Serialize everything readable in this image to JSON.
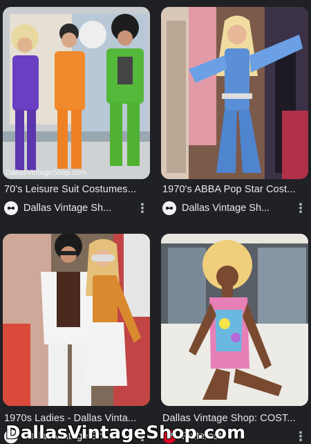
{
  "results": [
    {
      "caption": "70's Leisure Suit Costumes...",
      "source": "Dallas Vintage Sh...",
      "favicon": "dallas-vintage-favicon-icon",
      "watermark": "DallasVintageShop.com"
    },
    {
      "caption": "1970's ABBA Pop Star Cost...",
      "source": "Dallas Vintage Sh...",
      "favicon": "dallas-vintage-favicon-icon"
    },
    {
      "caption": "1970s Ladies - Dallas Vinta...",
      "source": "Dallas Vintage Sh...",
      "favicon": "dallas-vintage-favicon-icon"
    },
    {
      "caption": "Dallas Vintage Shop: COST...",
      "source": "Pinterest",
      "favicon": "pinterest-favicon-icon"
    }
  ],
  "overlay_watermark": "DallasVintageShop.com",
  "colors": {
    "background": "#202124",
    "text": "#e8eaed",
    "muted": "#bdc1c6"
  }
}
